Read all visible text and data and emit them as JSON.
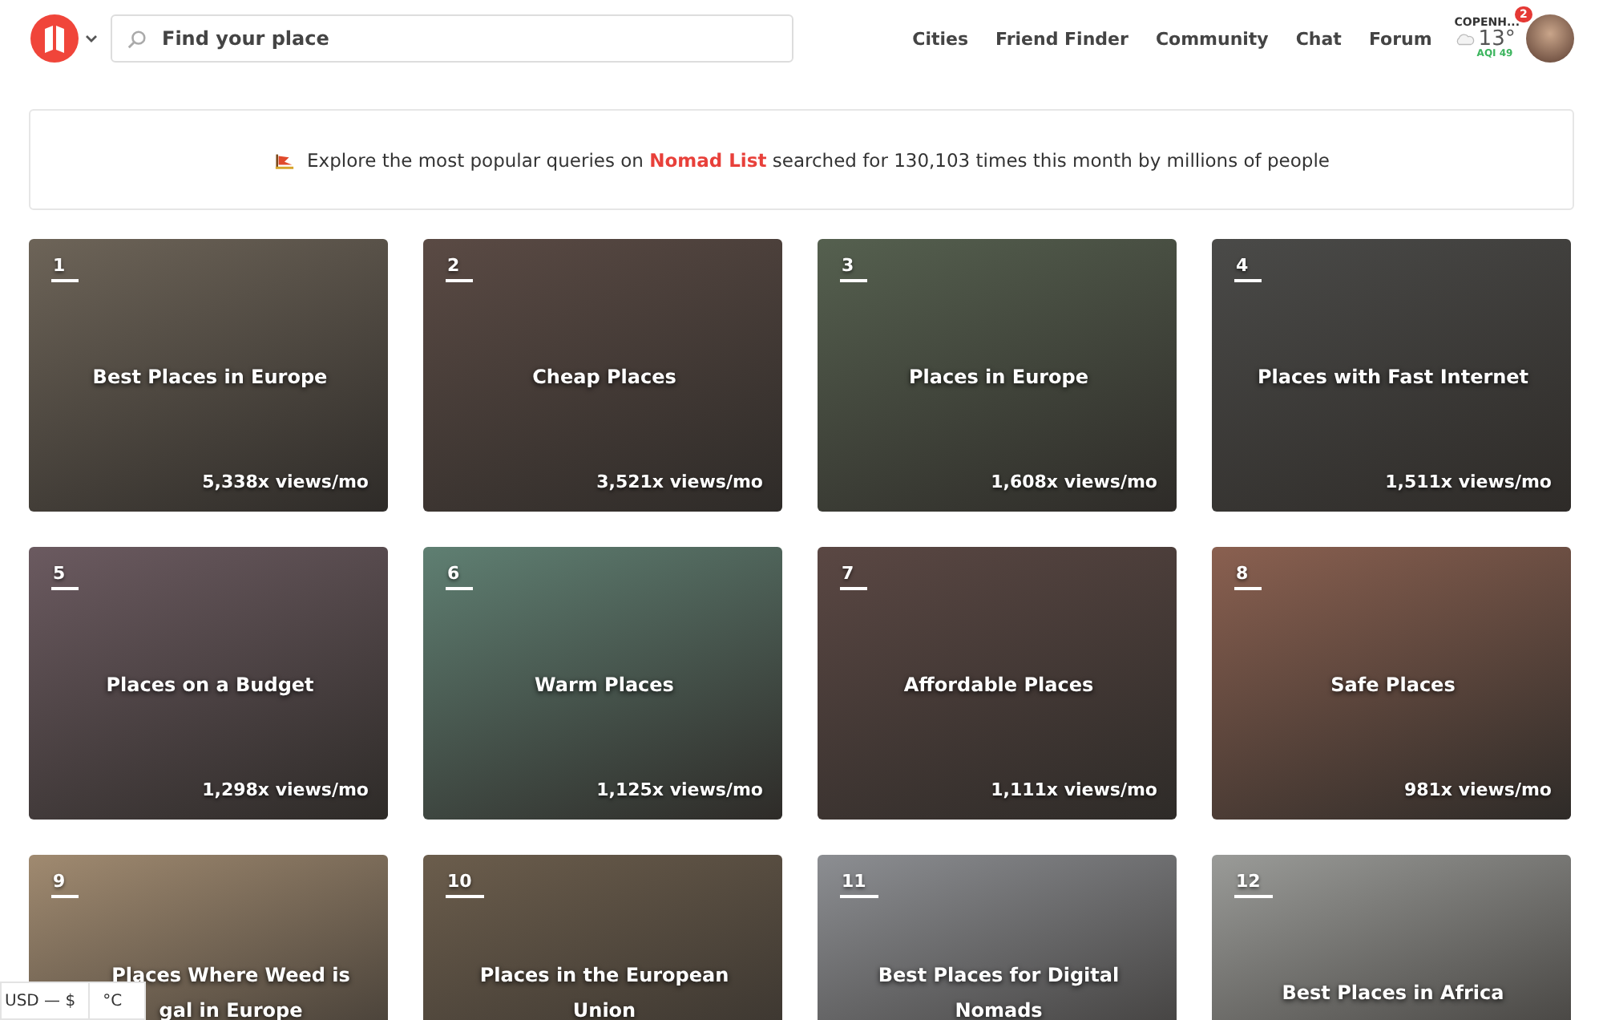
{
  "header": {
    "search": {
      "placeholder": "Find your place"
    },
    "nav": [
      "Cities",
      "Friend Finder",
      "Community",
      "Chat",
      "Forum"
    ],
    "weather": {
      "city": "COPENH...",
      "temperature": "13°",
      "aqi": "AQI 49"
    },
    "notification_count": "2"
  },
  "banner": {
    "parts": [
      "Explore the most popular queries on ",
      "Nomad List",
      " searched for 130,103 times this month by millions of people"
    ]
  },
  "cards": [
    {
      "rank": "1",
      "title_lines": [
        "Best Places in Europe"
      ],
      "views": "5,338x views/mo"
    },
    {
      "rank": "2",
      "title_lines": [
        "Cheap Places"
      ],
      "views": "3,521x views/mo"
    },
    {
      "rank": "3",
      "title_lines": [
        "Places in Europe"
      ],
      "views": "1,608x views/mo"
    },
    {
      "rank": "4",
      "title_lines": [
        "Places with Fast Internet"
      ],
      "views": "1,511x views/mo"
    },
    {
      "rank": "5",
      "title_lines": [
        "Places on a Budget"
      ],
      "views": "1,298x views/mo"
    },
    {
      "rank": "6",
      "title_lines": [
        "Warm Places"
      ],
      "views": "1,125x views/mo"
    },
    {
      "rank": "7",
      "title_lines": [
        "Affordable Places"
      ],
      "views": "1,111x views/mo"
    },
    {
      "rank": "8",
      "title_lines": [
        "Safe Places"
      ],
      "views": "981x views/mo"
    },
    {
      "rank": "9",
      "title_lines": [
        "Places Where Weed is",
        "gal in Europe"
      ]
    },
    {
      "rank": "10",
      "title_lines": [
        "Places in the European",
        "Union"
      ]
    },
    {
      "rank": "11",
      "title_lines": [
        "Best Places for Digital",
        "Nomads"
      ]
    },
    {
      "rank": "12",
      "title_lines": [
        "Best Places in Africa"
      ]
    }
  ],
  "footer": {
    "currency": "USD — $",
    "unit": "°C"
  }
}
